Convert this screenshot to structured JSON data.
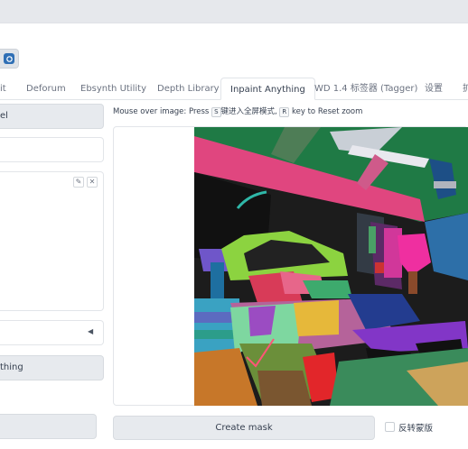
{
  "toolbar": {
    "refresh_icon": "refresh-icon"
  },
  "tabs": [
    {
      "label": "it"
    },
    {
      "label": "Deforum"
    },
    {
      "label": "Ebsynth Utility"
    },
    {
      "label": "Depth Library"
    },
    {
      "label": "Inpaint Anything"
    },
    {
      "label": "WD 1.4 标签器 (Tagger)"
    },
    {
      "label": "设置"
    },
    {
      "label": "扩"
    }
  ],
  "left_panel": {
    "model_button_label": "el",
    "run_button_label": "thing",
    "collapse_arrow": "◀"
  },
  "main": {
    "hint_prefix": "Mouse over image: Press",
    "hint_key1": "S",
    "hint_middle": "键进入全屏模式,",
    "hint_key2": "R",
    "hint_suffix": "key to Reset zoom"
  },
  "actions": {
    "create_mask_label": "Create mask",
    "invert_mask_label": "反转蒙版"
  },
  "colors": {
    "accent": "#2f6fb5"
  }
}
